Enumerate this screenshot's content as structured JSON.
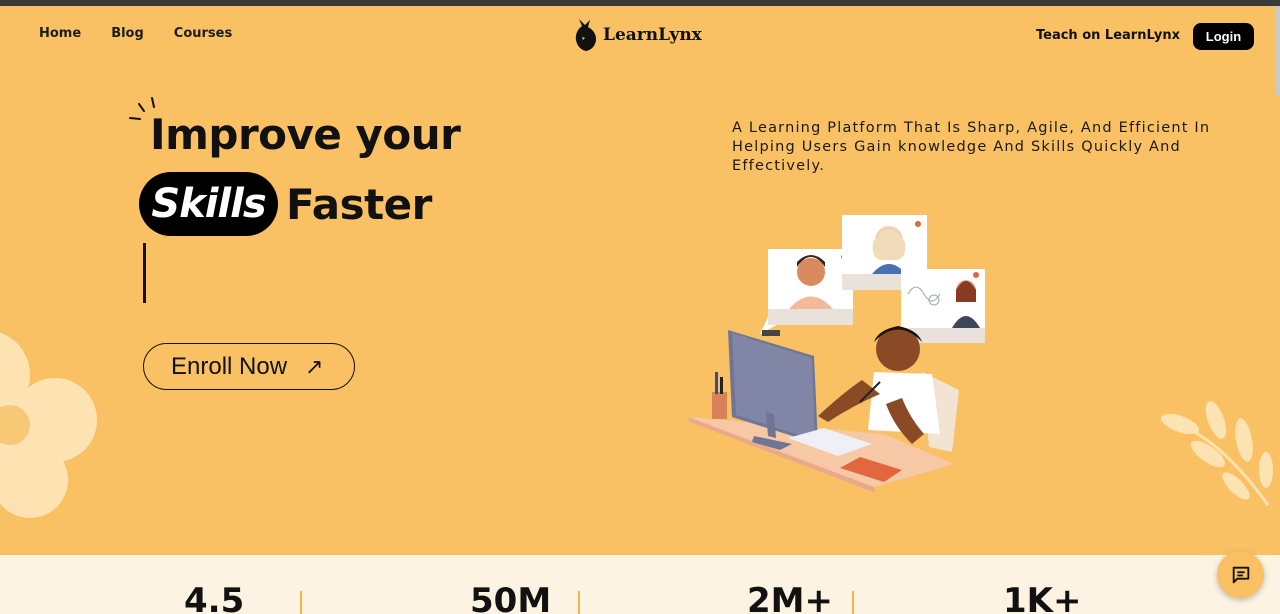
{
  "nav": {
    "links": [
      "Home",
      "Blog",
      "Courses"
    ],
    "brand": "LearnLynx",
    "teach_label": "Teach on LearnLynx",
    "login_label": "Login"
  },
  "hero": {
    "title_line1": "Improve your",
    "highlight_word": "Skills",
    "title_line2_rest": "Faster",
    "cta_label": "Enroll Now",
    "cta_icon": "arrow-up-right-icon",
    "tagline": "A Learning Platform That Is Sharp, Agile, And Efficient In Helping Users Gain knowledge And Skills Quickly And Effectively."
  },
  "stats": [
    "4.5",
    "50M",
    "2M+",
    "1K+"
  ],
  "colors": {
    "background": "#f9c163",
    "accent": "#000000",
    "stats_bg": "#fdf3e3",
    "divider": "#f2b648"
  },
  "icons": {
    "logo": "lynx-logo-icon",
    "chat": "chat-bubble-icon"
  }
}
